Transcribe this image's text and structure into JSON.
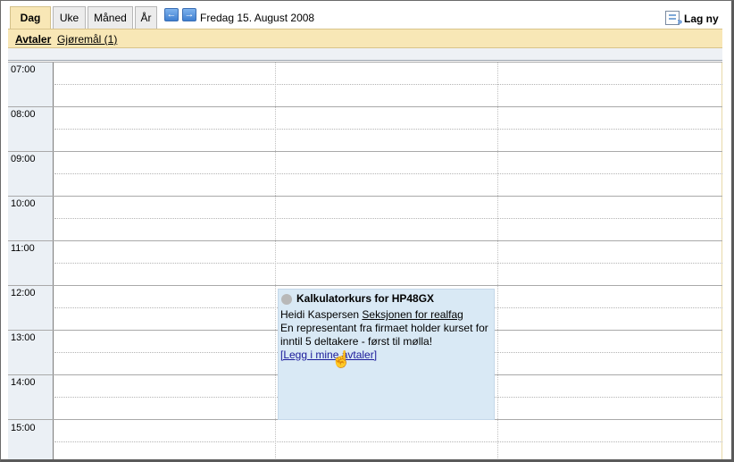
{
  "tabs": [
    {
      "label": "Dag",
      "active": true
    },
    {
      "label": "Uke",
      "active": false
    },
    {
      "label": "Måned",
      "active": false
    },
    {
      "label": "År",
      "active": false
    }
  ],
  "nav": {
    "prev_icon": "arrow-left-icon",
    "next_icon": "arrow-right-icon"
  },
  "date_label": "Fredag 15. August 2008",
  "new_button": {
    "label": "Lag ny",
    "icon": "new-appointment-icon"
  },
  "subnav": {
    "appointments": "Avtaler",
    "tasks": "Gjøremål (1)"
  },
  "hours": [
    "07:00",
    "08:00",
    "09:00",
    "10:00",
    "11:00",
    "12:00",
    "13:00",
    "14:00",
    "15:00"
  ],
  "appointment": {
    "title": "Kalkulatorkurs for HP48GX",
    "person": "Heidi Kaspersen",
    "section": "Seksjonen for realfag",
    "description_line1": "En representant fra firmaet holder kurset for",
    "description_line2": "inntil 5 deltakere - først til mølla!",
    "action_link": "[Legg i mine avtaler]"
  },
  "colors": {
    "active_tab": "#f8e7b6",
    "subbar": "#f8e7b6",
    "gutter": "#ebf0f5",
    "appointment_bg": "#d9e9f5"
  }
}
